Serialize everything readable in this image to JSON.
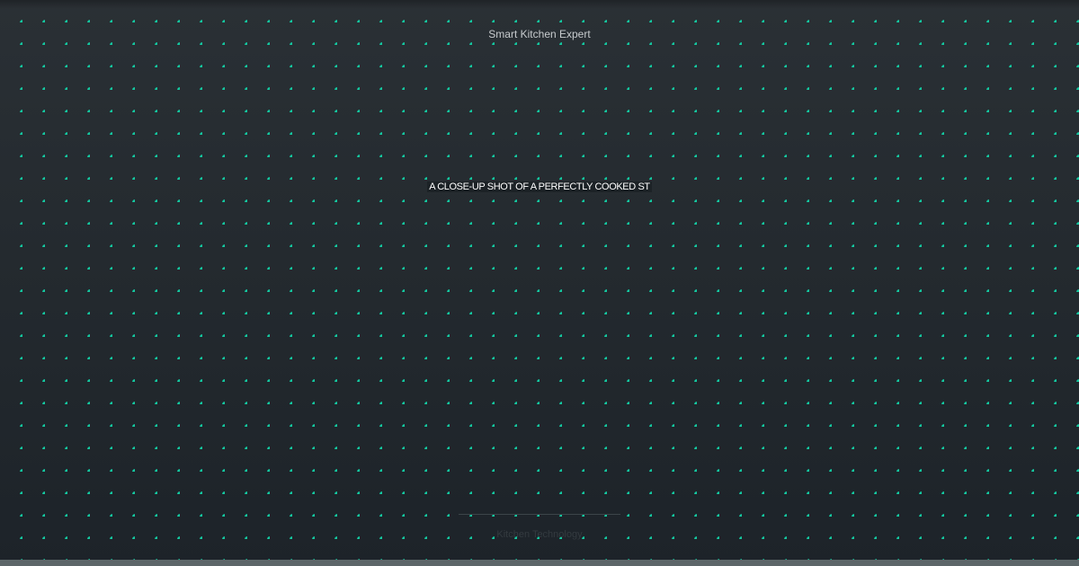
{
  "header": {
    "brand": "Smart Kitchen Expert"
  },
  "main": {
    "headline": "A CLOSE-UP SHOT OF A PERFECTLY COOKED ST"
  },
  "footer": {
    "label": "Kitchen Technology"
  },
  "theme": {
    "background": "#252b30",
    "dot_color": "#14c8a0",
    "text_color": "#ffffff",
    "muted_text": "#c7cbce"
  }
}
